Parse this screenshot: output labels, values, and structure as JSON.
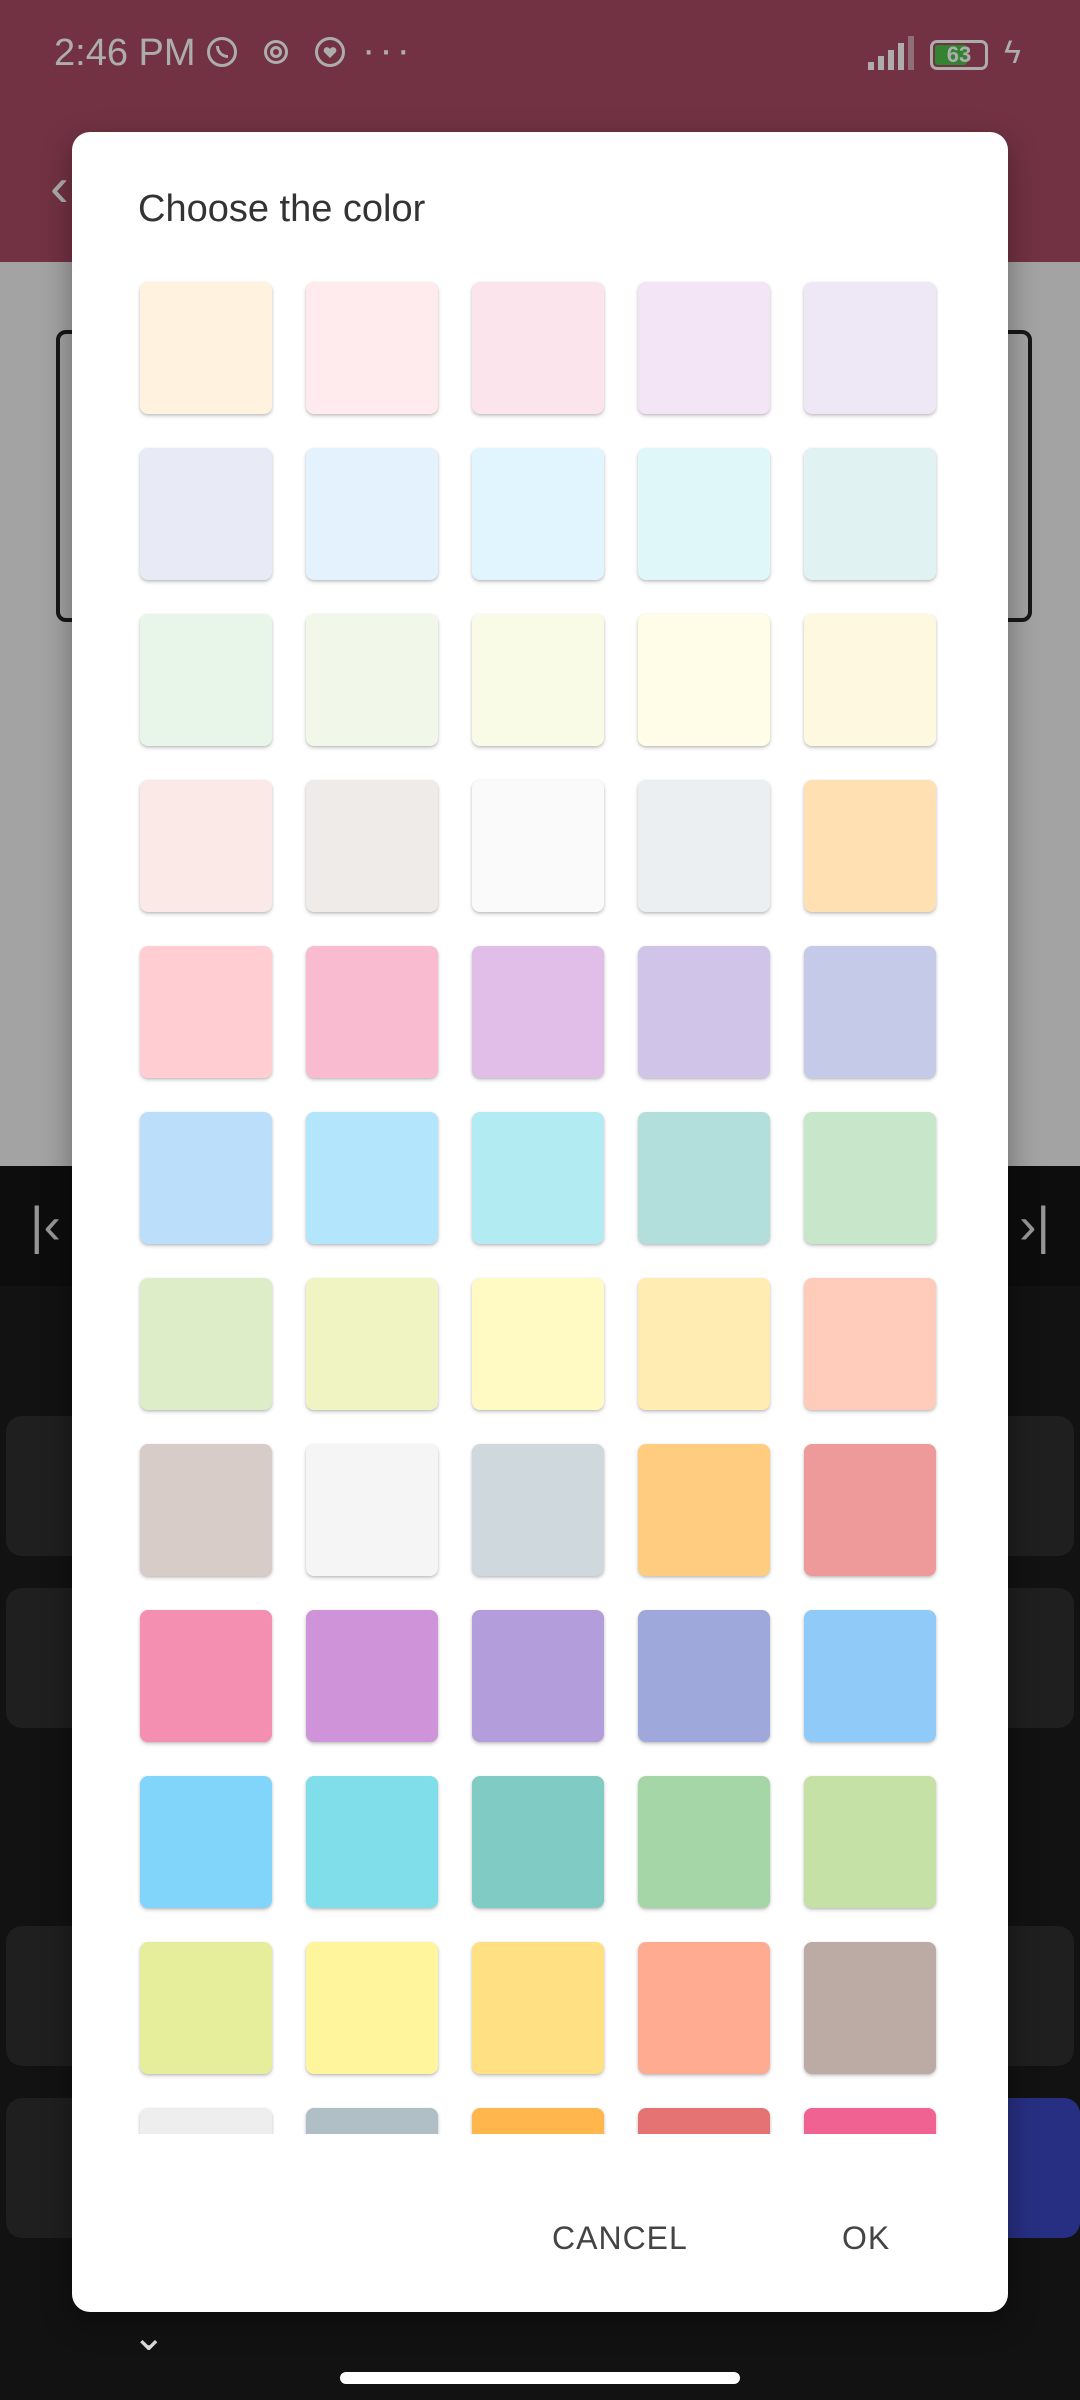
{
  "status_bar": {
    "time": "2:46 PM",
    "battery_level": "63",
    "icons": [
      "whatsapp-icon",
      "settings-icon",
      "chat-heart-icon",
      "more-icon",
      "signal-icon",
      "battery-icon",
      "charging-icon"
    ]
  },
  "dialog": {
    "title": "Choose the color",
    "cancel_label": "CANCEL",
    "ok_label": "OK",
    "colors": [
      "#FFF3E0",
      "#FFEBEE",
      "#FCE4EC",
      "#F3E5F5",
      "#EDE7F6",
      "#E8EAF6",
      "#E3F2FD",
      "#E1F5FE",
      "#E0F7FA",
      "#E0F2F1",
      "#E8F5E9",
      "#F1F8E9",
      "#F9FBE7",
      "#FFFDE7",
      "#FFF8E1",
      "#FBE9E7",
      "#EFEBE9",
      "#FAFAFA",
      "#ECEFF1",
      "#FFE0B2",
      "#FFCDD2",
      "#F8BBD0",
      "#E1BEE7",
      "#D1C4E9",
      "#C5CAE9",
      "#BBDEFB",
      "#B3E5FC",
      "#B2EBF2",
      "#B2DFDB",
      "#C8E6C9",
      "#DCEDC8",
      "#F0F4C3",
      "#FFF9C4",
      "#FFECB3",
      "#FFCCBC",
      "#D7CCC8",
      "#F5F5F5",
      "#CFD8DC",
      "#FFCC80",
      "#EF9A9A",
      "#F48FB1",
      "#CE93D8",
      "#B39DDB",
      "#9FA8DA",
      "#90CAF9",
      "#81D4FA",
      "#80DEEA",
      "#80CBC4",
      "#A5D6A7",
      "#C5E1A5",
      "#E6EE9C",
      "#FFF59D",
      "#FFE082",
      "#FFAB91",
      "#BCAAA4",
      "#EEEEEE",
      "#B0BEC5",
      "#FFB74D",
      "#E57373",
      "#F06292"
    ]
  }
}
